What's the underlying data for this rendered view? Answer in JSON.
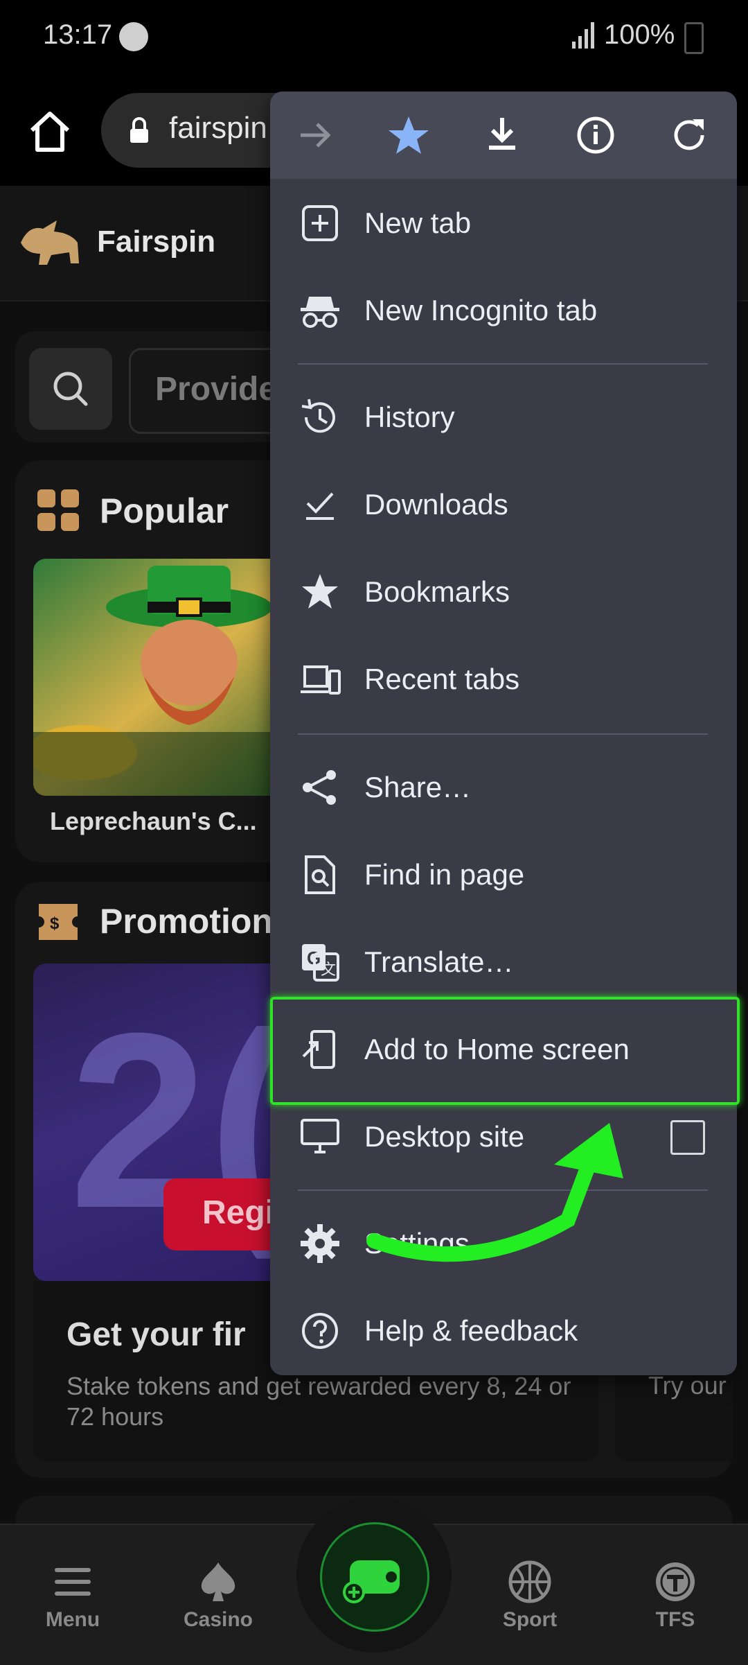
{
  "status_bar": {
    "time": "13:17",
    "battery": "100%"
  },
  "browser": {
    "url_partial": "fairspin"
  },
  "site": {
    "brand": "Fairspin",
    "search_placeholder": "Provide"
  },
  "popular": {
    "title": "Popular",
    "game_title": "Leprechaun's C..."
  },
  "promotions": {
    "title": "Promotion",
    "image_number": "2(",
    "register_label": "Regi",
    "card_title": "Get your fir",
    "card_desc": "Stake tokens and get rewarded every 8, 24 or 72 hours",
    "card2_desc": "Try our"
  },
  "bottom_nav": [
    {
      "label": "Menu"
    },
    {
      "label": "Casino"
    },
    {
      "label": "Sport"
    },
    {
      "label": "TFS"
    }
  ],
  "menu": {
    "toolbar_icons": [
      "forward-icon",
      "bookmark-star-icon",
      "download-icon",
      "info-icon",
      "reload-icon"
    ],
    "items": [
      {
        "label": "New tab",
        "icon": "new-tab-icon"
      },
      {
        "label": "New Incognito tab",
        "icon": "incognito-icon"
      },
      {
        "label": "History",
        "icon": "history-icon"
      },
      {
        "label": "Downloads",
        "icon": "downloads-icon"
      },
      {
        "label": "Bookmarks",
        "icon": "bookmarks-icon"
      },
      {
        "label": "Recent tabs",
        "icon": "recent-tabs-icon"
      },
      {
        "label": "Share…",
        "icon": "share-icon"
      },
      {
        "label": "Find in page",
        "icon": "find-in-page-icon"
      },
      {
        "label": "Translate…",
        "icon": "translate-icon"
      },
      {
        "label": "Add to Home screen",
        "icon": "add-to-home-icon"
      },
      {
        "label": "Desktop site",
        "icon": "desktop-icon"
      },
      {
        "label": "Settings",
        "icon": "settings-icon"
      },
      {
        "label": "Help & feedback",
        "icon": "help-icon"
      }
    ]
  },
  "colors": {
    "highlight": "#33e02a",
    "menu_bg": "#3a3b46",
    "brand_gold": "#c8a06a",
    "accent_green": "#1b8f2f"
  }
}
